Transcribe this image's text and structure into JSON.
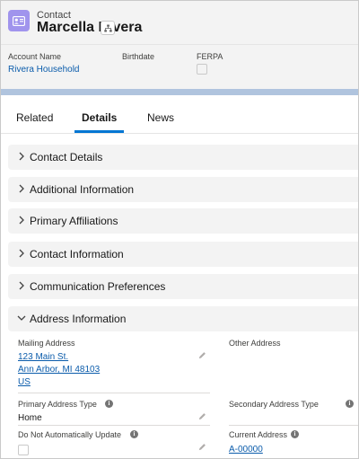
{
  "header": {
    "object_type": "Contact",
    "record_name": "Marcella Rivera",
    "object_icon": "contact-card-icon",
    "hierarchy_icon": "hierarchy-icon"
  },
  "highlights": {
    "account_name_label": "Account Name",
    "account_name_value": "Rivera Household",
    "birthdate_label": "Birthdate",
    "ferpa_label": "FERPA"
  },
  "tabs": [
    {
      "label": "Related",
      "active": false
    },
    {
      "label": "Details",
      "active": true
    },
    {
      "label": "News",
      "active": false
    }
  ],
  "sections": [
    {
      "title": "Contact Details",
      "expanded": false
    },
    {
      "title": "Additional Information",
      "expanded": false
    },
    {
      "title": "Primary Affiliations",
      "expanded": false
    },
    {
      "title": "Contact Information",
      "expanded": false
    },
    {
      "title": "Communication Preferences",
      "expanded": false
    },
    {
      "title": "Address Information",
      "expanded": true
    }
  ],
  "address": {
    "mailing_label": "Mailing Address",
    "mailing_line1": "123 Main St.",
    "mailing_line2": "Ann Arbor, MI 48103",
    "mailing_line3": "US",
    "other_label": "Other Address",
    "primary_type_label": "Primary Address Type",
    "primary_type_value": "Home",
    "secondary_type_label": "Secondary Address Type",
    "do_not_update_label": "Do Not Automatically Update",
    "current_address_label": "Current Address",
    "current_address_value": "A-00000"
  },
  "colors": {
    "brand_blue": "#0176d3",
    "link": "#0b5cab",
    "contact_icon_bg": "#a094ed",
    "section_bg": "#f3f3f3"
  }
}
